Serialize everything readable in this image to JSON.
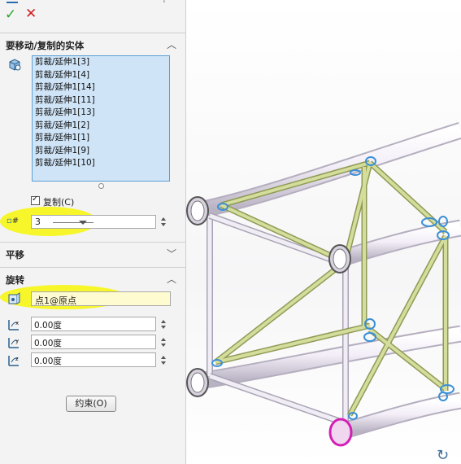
{
  "toolbar": {
    "ok_symbol": "✓",
    "cancel_symbol": "✕"
  },
  "bodies_section": {
    "title": "要移动/复制的实体",
    "items": [
      "剪裁/延伸1[3]",
      "剪裁/延伸1[4]",
      "剪裁/延伸1[14]",
      "剪裁/延伸1[11]",
      "剪裁/延伸1[13]",
      "剪裁/延伸1[2]",
      "剪裁/延伸1[1]",
      "剪裁/延伸1[9]",
      "剪裁/延伸1[10]"
    ],
    "copy_label": "复制(C)",
    "copy_checked": true,
    "copies_value": "3"
  },
  "translate_section": {
    "title": "平移"
  },
  "rotate_section": {
    "title": "旋转",
    "origin_value": "点1@原点",
    "angles": [
      "0.00度",
      "0.00度",
      "0.00度"
    ]
  },
  "constraint_button": "约束(O)",
  "colors": {
    "highlight": "#f6f62a",
    "list_bg": "#cfe4f7",
    "tube": "#e7e2ee",
    "brace": "#c9d48a",
    "selection": "#3a8fd8",
    "magenta_edge": "#d31fb5"
  },
  "icons": {
    "ok": "check-icon",
    "cancel": "close-icon",
    "bodies": "bodies-icon",
    "copies": "copies-count-icon",
    "origin": "rotation-origin-icon",
    "rot_x": "rotate-x-icon",
    "rot_y": "rotate-y-icon",
    "rot_z": "rotate-z-icon",
    "view_rotate": "rotate-view-icon"
  }
}
